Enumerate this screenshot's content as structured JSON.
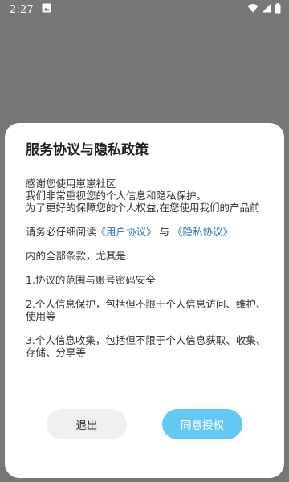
{
  "status_bar": {
    "time": "2:27",
    "notification_icon": "image-notification-icon",
    "wifi_icon": "wifi-icon",
    "signal_icon": "cell-signal-icon",
    "battery_icon": "battery-icon"
  },
  "dialog": {
    "title": "服务协议与隐私政策",
    "intro_lines": [
      "感谢您使用崽崽社区",
      "我们非常重视您的个人信息和隐私保护。",
      "为了更好的保障您的个人权益,在您使用我们的产品前"
    ],
    "read_prefix": "请务必仔细阅读",
    "user_agreement_link": "《用户协议》",
    "connector": "与",
    "privacy_policy_link": "《隐私协议》",
    "terms_intro": "内的全部条款，尤其是:",
    "points": [
      "1.协议的范围与账号密码安全",
      "2.个人信息保护，包括但不限于个人信息访问、维护、使用等",
      "3.个人信息收集，包括但不限于个人信息获取、收集、存储、分享等"
    ],
    "exit_label": "退出",
    "agree_label": "同意授权"
  },
  "colors": {
    "overlay": "#777777",
    "link": "#2f6fd6",
    "agree_button": "#64c8f4",
    "exit_button": "#efefef"
  }
}
